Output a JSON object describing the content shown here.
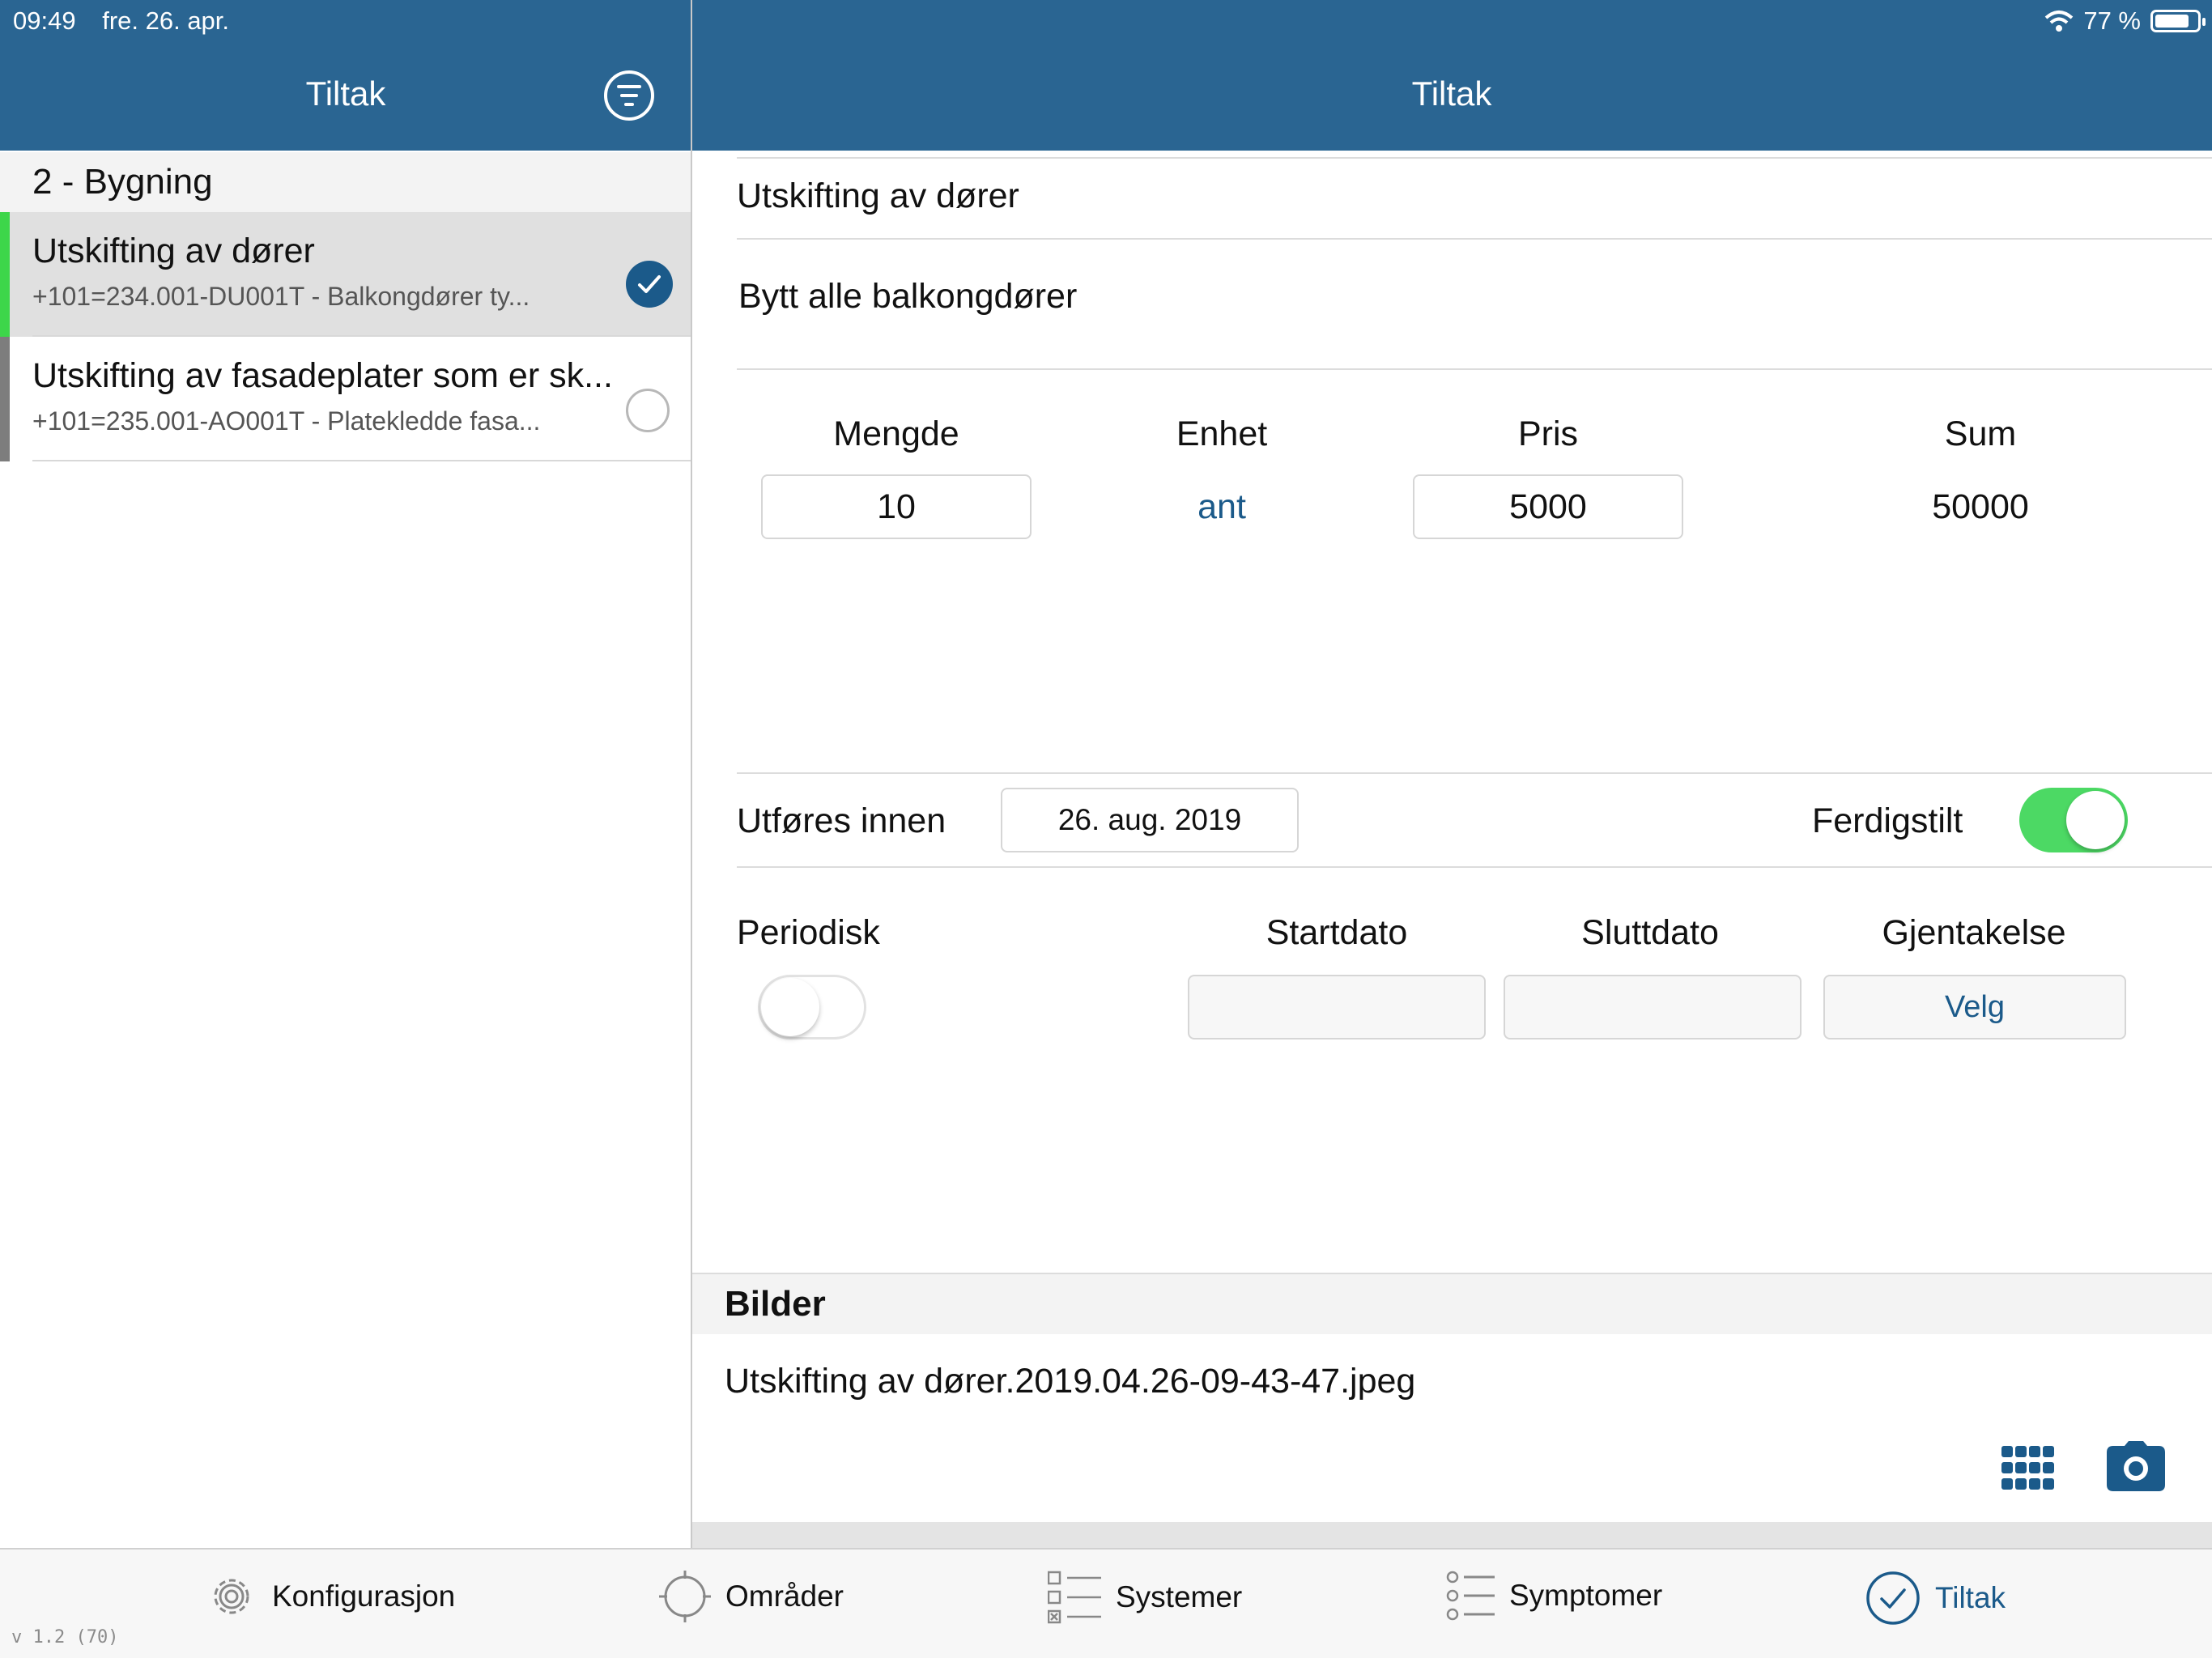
{
  "status_bar": {
    "time": "09:49",
    "date": "fre. 26. apr.",
    "battery": "77 %",
    "icons": [
      "wifi-icon",
      "battery-icon"
    ]
  },
  "left_panel": {
    "title": "Tiltak",
    "section": "2 - Bygning",
    "items": [
      {
        "title": "Utskifting av dører",
        "subtitle": "+101=234.001-DU001T - Balkongdører ty...",
        "status_color": "#3dd64a",
        "checked": true
      },
      {
        "title": "Utskifting av fasadeplater som er sk...",
        "subtitle": "+101=235.001-AO001T - Platekledde fasa...",
        "status_color": "#7d7d7d",
        "checked": false
      }
    ]
  },
  "detail": {
    "title": "Tiltak",
    "name": "Utskifting av dører",
    "description": "Bytt alle balkongdører",
    "columns": {
      "mengde_label": "Mengde",
      "enhet_label": "Enhet",
      "pris_label": "Pris",
      "sum_label": "Sum"
    },
    "values": {
      "mengde": "10",
      "enhet": "ant",
      "pris": "5000",
      "sum": "50000"
    },
    "deadline_label": "Utføres innen",
    "deadline_value": "26. aug. 2019",
    "completed_label": "Ferdigstilt",
    "completed": true,
    "periodic_label": "Periodisk",
    "periodic": false,
    "start_label": "Startdato",
    "end_label": "Sluttdato",
    "repeat_label": "Gjentakelse",
    "repeat_button": "Velg",
    "images_header": "Bilder",
    "image_file": "Utskifting av dører.2019.04.26-09-43-47.jpeg"
  },
  "tabs": [
    {
      "label": "Konfigurasjon",
      "icon": "gear-icon",
      "active": false
    },
    {
      "label": "Områder",
      "icon": "crosshair-icon",
      "active": false
    },
    {
      "label": "Systemer",
      "icon": "checklist-icon",
      "active": false
    },
    {
      "label": "Symptomer",
      "icon": "list-icon",
      "active": false
    },
    {
      "label": "Tiltak",
      "icon": "check-circle-icon",
      "active": true
    }
  ],
  "version": "v 1.2 (70)",
  "colors": {
    "nav_bar": "#2a6592",
    "accent": "#1b5a8a",
    "toggle_on": "#4cd964"
  }
}
